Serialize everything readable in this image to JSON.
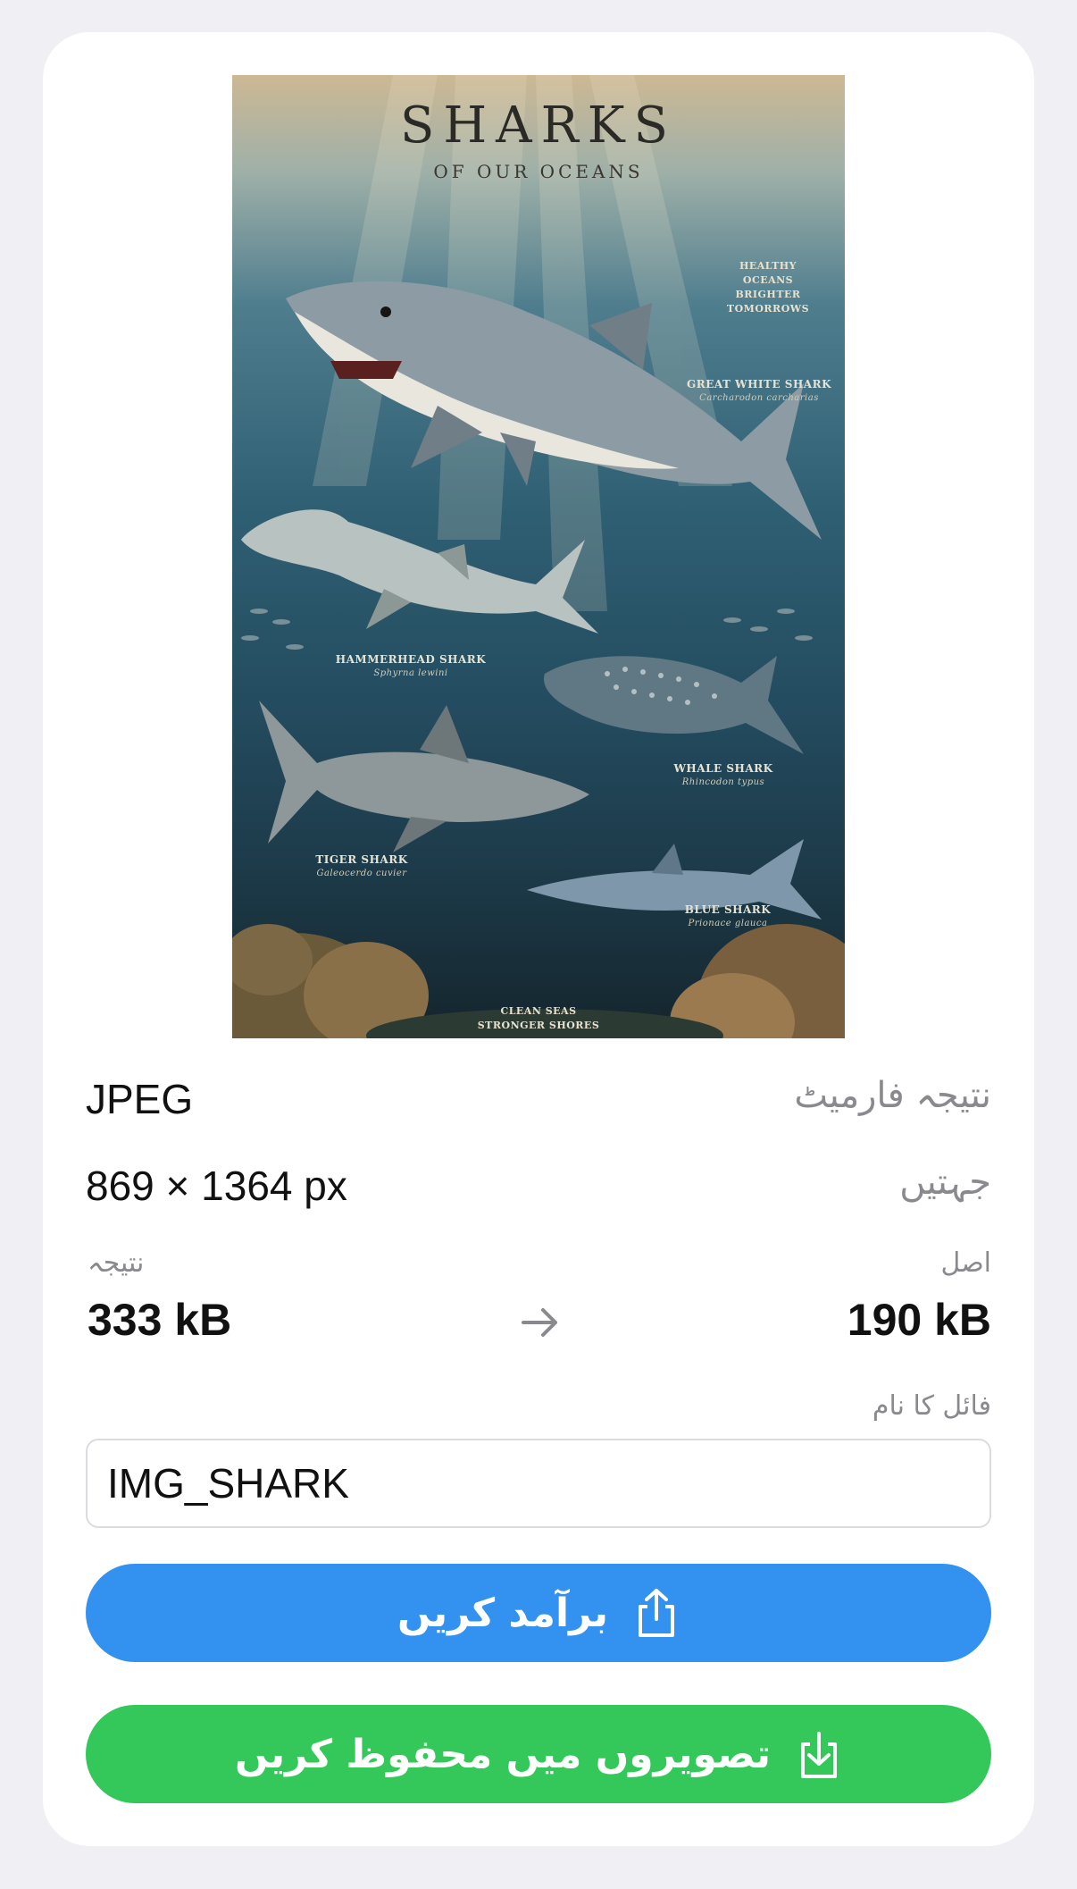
{
  "poster": {
    "title": "SHARKS",
    "subtitle": "OF OUR OCEANS",
    "tagline": "HEALTHY OCEANS\nBRIGHTER\nTOMORROWS",
    "labels": [
      {
        "name": "GREAT WHITE SHARK",
        "sci": "Carcharodon carcharias"
      },
      {
        "name": "HAMMERHEAD SHARK",
        "sci": "Sphyrna lewini"
      },
      {
        "name": "WHALE SHARK",
        "sci": "Rhincodon typus"
      },
      {
        "name": "TIGER SHARK",
        "sci": "Galeocerdo cuvier"
      },
      {
        "name": "BLUE SHARK",
        "sci": "Prionace glauca"
      }
    ],
    "footer": "CLEAN SEAS\nSTRONGER SHORES"
  },
  "info": {
    "format_label": "نتیجہ فارمیٹ",
    "format_value": "JPEG",
    "dimensions_label": "جہتیں",
    "dimensions_value": "869 × 1364 px"
  },
  "sizes": {
    "original_label": "اصل",
    "original_value": "190 kB",
    "result_label": "نتیجہ",
    "result_value": "333 kB"
  },
  "filename": {
    "label": "فائل کا نام",
    "value": "IMG_SHARK"
  },
  "buttons": {
    "export_label": "برآمد کریں",
    "save_label": "تصویروں میں محفوظ کریں"
  },
  "colors": {
    "export": "#3391f0",
    "save": "#34c759",
    "background": "#efeff4"
  },
  "icons": {
    "export": "share-icon",
    "save": "save-to-photos-icon",
    "arrow": "arrow-right-icon"
  }
}
